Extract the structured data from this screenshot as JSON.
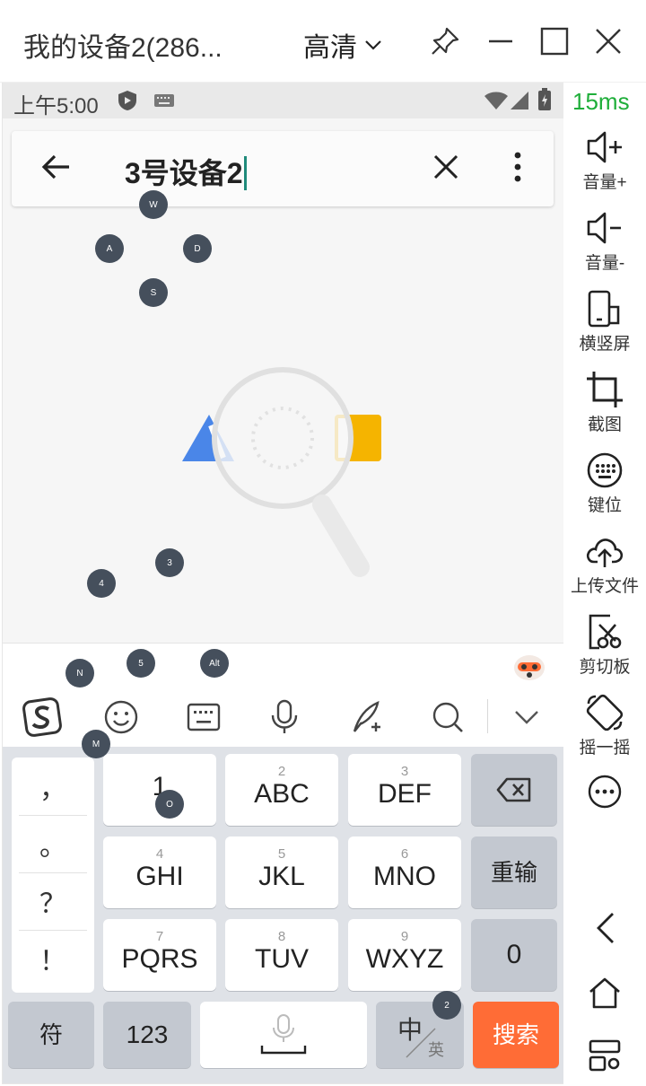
{
  "window": {
    "title": "我的设备2(286...",
    "quality": "高清"
  },
  "status_bar": {
    "time": "上午5:00"
  },
  "search": {
    "query": "3号设备2"
  },
  "latency": "15ms",
  "side_panel": {
    "volume_up": "音量+",
    "volume_down": "音量-",
    "rotate": "横竖屏",
    "screenshot": "截图",
    "keymap": "键位",
    "upload": "上传文件",
    "clipboard": "剪切板",
    "shake": "摇一摇"
  },
  "keyboard": {
    "punctuation": [
      "，",
      "。",
      "？",
      "！"
    ],
    "rows": [
      [
        {
          "num": "",
          "label": "1"
        },
        {
          "num": "2",
          "label": "ABC"
        },
        {
          "num": "3",
          "label": "DEF"
        }
      ],
      [
        {
          "num": "4",
          "label": "GHI"
        },
        {
          "num": "5",
          "label": "JKL"
        },
        {
          "num": "6",
          "label": "MNO"
        }
      ],
      [
        {
          "num": "7",
          "label": "PQRS"
        },
        {
          "num": "8",
          "label": "TUV"
        },
        {
          "num": "9",
          "label": "WXYZ"
        }
      ]
    ],
    "reinput": "重输",
    "zero": "0",
    "symbol": "符",
    "numeric": "123",
    "lang_main": "中",
    "lang_alt": "英",
    "search": "搜索"
  },
  "markers": [
    "W",
    "A",
    "D",
    "S",
    "3",
    "4",
    "N",
    "5",
    "Alt",
    "M",
    "O",
    "2"
  ],
  "colors": {
    "accent_green": "#1fae3a",
    "search_key": "#ff6c36",
    "marker": "#454f5c"
  }
}
